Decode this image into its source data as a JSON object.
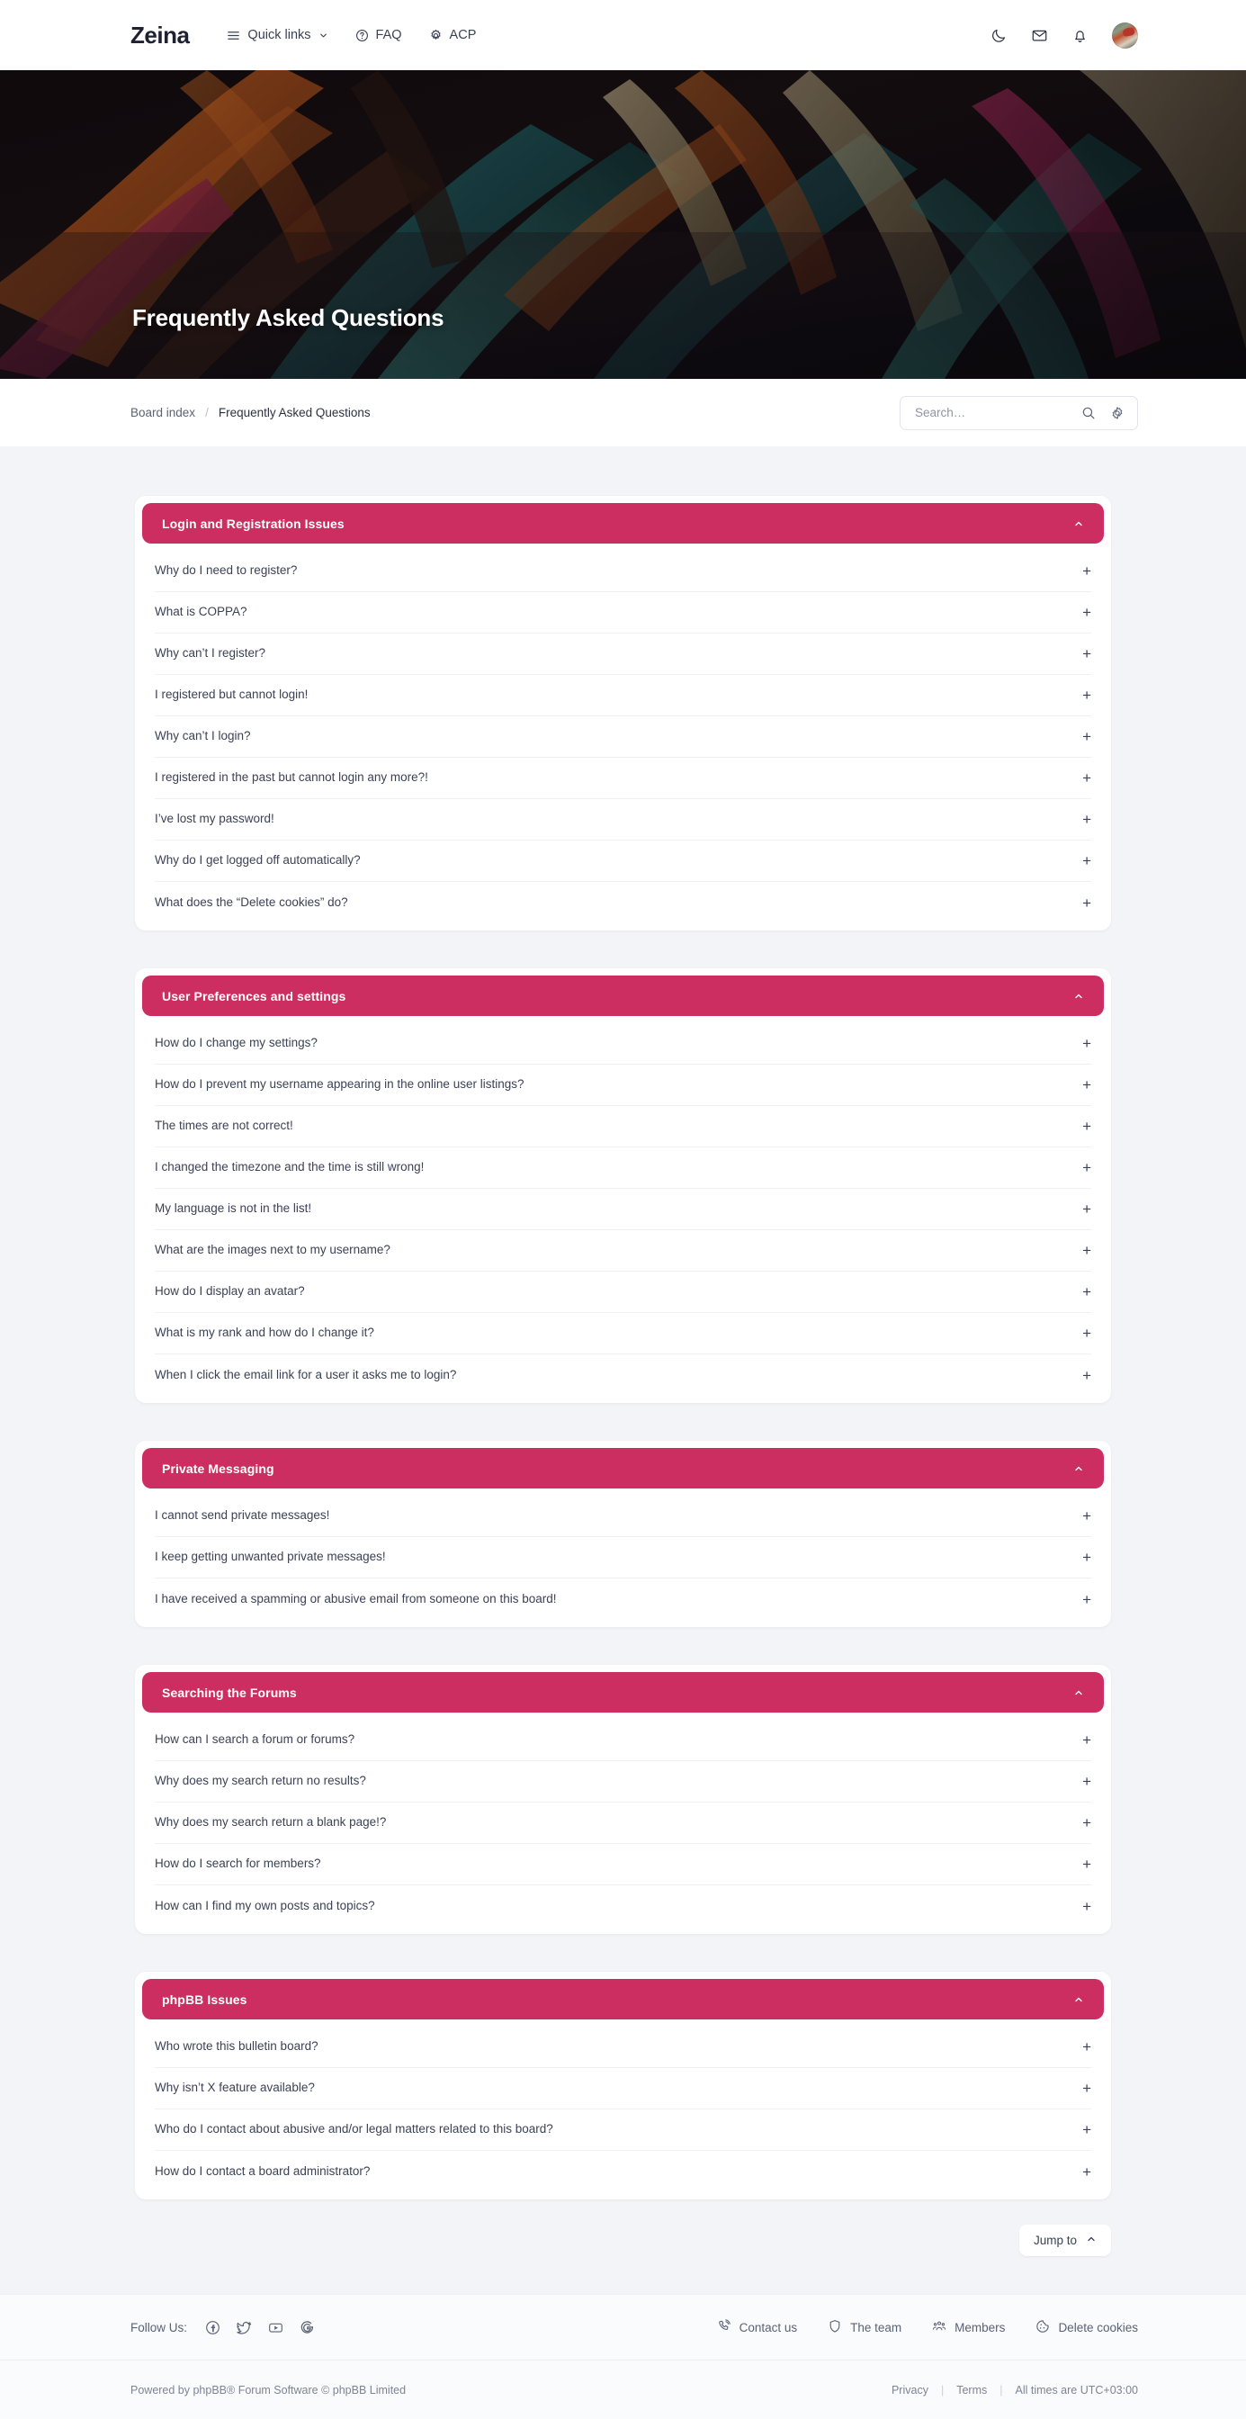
{
  "header": {
    "brand": "Zeina",
    "nav": [
      {
        "label": "Quick links",
        "icon": "hamburger-icon",
        "has_chevron": true
      },
      {
        "label": "FAQ",
        "icon": "question-circle-icon",
        "has_chevron": false
      },
      {
        "label": "ACP",
        "icon": "gear-icon",
        "has_chevron": false
      }
    ],
    "icons": [
      {
        "name": "dark-mode-moon-icon"
      },
      {
        "name": "messages-envelope-icon"
      },
      {
        "name": "notifications-bell-icon"
      },
      {
        "name": "user-avatar"
      }
    ]
  },
  "hero": {
    "title": "Frequently Asked Questions"
  },
  "breadcrumb": {
    "board_index": "Board index",
    "separator": "/",
    "current": "Frequently Asked Questions"
  },
  "search": {
    "placeholder": "Search…",
    "value": "",
    "search_icon": "search-icon",
    "advanced_icon": "gear-icon"
  },
  "colors": {
    "accent": "#cc2e62",
    "page_bg": "#f2f4f7",
    "card_bg": "#ffffff",
    "text": "#3b4255",
    "muted": "#7d8494"
  },
  "faq_sections": [
    {
      "title": "Login and Registration Issues",
      "expanded": true,
      "questions": [
        "Why do I need to register?",
        "What is COPPA?",
        "Why can’t I register?",
        "I registered but cannot login!",
        "Why can’t I login?",
        "I registered in the past but cannot login any more?!",
        "I’ve lost my password!",
        "Why do I get logged off automatically?",
        "What does the “Delete cookies” do?"
      ]
    },
    {
      "title": "User Preferences and settings",
      "expanded": true,
      "questions": [
        "How do I change my settings?",
        "How do I prevent my username appearing in the online user listings?",
        "The times are not correct!",
        "I changed the timezone and the time is still wrong!",
        "My language is not in the list!",
        "What are the images next to my username?",
        "How do I display an avatar?",
        "What is my rank and how do I change it?",
        "When I click the email link for a user it asks me to login?"
      ]
    },
    {
      "title": "Private Messaging",
      "expanded": true,
      "questions": [
        "I cannot send private messages!",
        "I keep getting unwanted private messages!",
        "I have received a spamming or abusive email from someone on this board!"
      ]
    },
    {
      "title": "Searching the Forums",
      "expanded": true,
      "questions": [
        "How can I search a forum or forums?",
        "Why does my search return no results?",
        "Why does my search return a blank page!?",
        "How do I search for members?",
        "How can I find my own posts and topics?"
      ]
    },
    {
      "title": "phpBB Issues",
      "expanded": true,
      "questions": [
        "Who wrote this bulletin board?",
        "Why isn’t X feature available?",
        "Who do I contact about abusive and/or legal matters related to this board?",
        "How do I contact a board administrator?"
      ]
    }
  ],
  "jump_to": {
    "label": "Jump to",
    "icon": "chevron-up-icon"
  },
  "footer": {
    "follow_label": "Follow Us:",
    "socials": [
      {
        "name": "facebook-icon"
      },
      {
        "name": "twitter-icon"
      },
      {
        "name": "youtube-icon"
      },
      {
        "name": "google-icon"
      }
    ],
    "links": [
      {
        "label": "Contact us",
        "icon": "phone-icon"
      },
      {
        "label": "The team",
        "icon": "shield-icon"
      },
      {
        "label": "Members",
        "icon": "people-icon"
      },
      {
        "label": "Delete cookies",
        "icon": "cookie-icon"
      }
    ],
    "powered_by": "Powered by phpBB® Forum Software © phpBB Limited",
    "privacy": "Privacy",
    "terms": "Terms",
    "divider": "|",
    "timezone": "All times are UTC+03:00"
  }
}
